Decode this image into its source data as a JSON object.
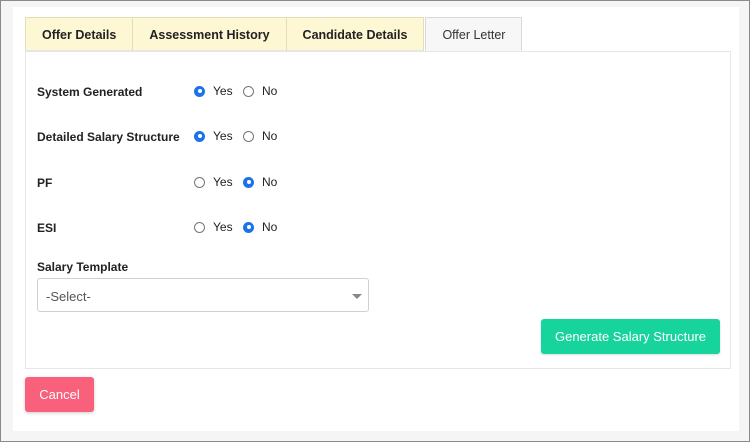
{
  "tabs": [
    {
      "label": "Offer Details",
      "active": false
    },
    {
      "label": "Assessment History",
      "active": false
    },
    {
      "label": "Candidate Details",
      "active": false
    },
    {
      "label": "Offer Letter",
      "active": true
    }
  ],
  "form": {
    "rows": [
      {
        "label": "System Generated",
        "yes": "Yes",
        "no": "No",
        "selected": "yes"
      },
      {
        "label": "Detailed Salary Structure",
        "yes": "Yes",
        "no": "No",
        "selected": "yes"
      },
      {
        "label": "PF",
        "yes": "Yes",
        "no": "No",
        "selected": "no"
      },
      {
        "label": "ESI",
        "yes": "Yes",
        "no": "No",
        "selected": "no"
      }
    ],
    "salary_template": {
      "label": "Salary Template",
      "value": "-Select-"
    },
    "generate_label": "Generate Salary Structure"
  },
  "cancel_label": "Cancel",
  "colors": {
    "tab_bg": "#fdf7d3",
    "radio_checked": "#1a73e8",
    "generate_button": "#17d49c",
    "cancel_button": "#f8607c"
  }
}
